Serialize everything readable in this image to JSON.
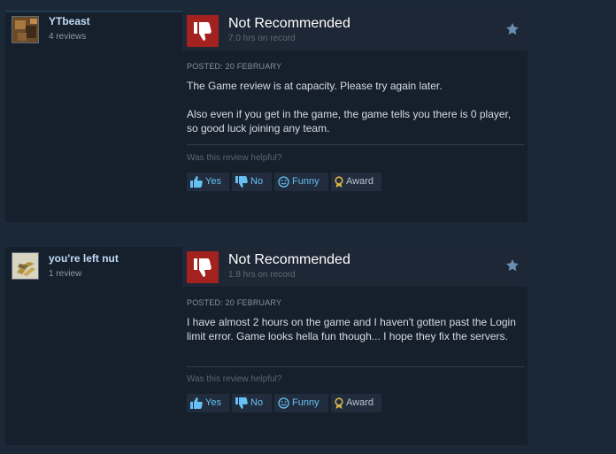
{
  "reviews": [
    {
      "author": "YTbeast",
      "review_count": "4 reviews",
      "verdict": "Not Recommended",
      "hours": "7.0 hrs on record",
      "posted": "POSTED: 20 FEBRUARY",
      "body": [
        "The Game review is at capacity. Please try again later.",
        "Also even if you get in the game, the game tells you there is 0 player, so good luck joining any team."
      ],
      "helpful_prompt": "Was this review helpful?",
      "buttons": {
        "yes": "Yes",
        "no": "No",
        "funny": "Funny",
        "award": "Award"
      }
    },
    {
      "author": "you're left nut",
      "review_count": "1 review",
      "verdict": "Not Recommended",
      "hours": "1.8 hrs on record",
      "posted": "POSTED: 20 FEBRUARY",
      "body": [
        "I have almost 2 hours on the game and I haven't gotten past the Login limit error. Game looks hella fun though... I hope they fix the servers."
      ],
      "helpful_prompt": "Was this review helpful?",
      "buttons": {
        "yes": "Yes",
        "no": "No",
        "funny": "Funny",
        "award": "Award"
      }
    }
  ],
  "colors": {
    "page_bg": "#1b2838",
    "card_bg": "#16202d",
    "thumb_red": "#a3221f",
    "link_blue": "#66c0f4",
    "award_gold": "#d9b44a"
  },
  "icons": [
    "avatar",
    "thumbs-down-icon",
    "star-icon",
    "thumbs-up-icon",
    "thumbs-down-small-icon",
    "smiley-icon",
    "award-ribbon-icon"
  ]
}
